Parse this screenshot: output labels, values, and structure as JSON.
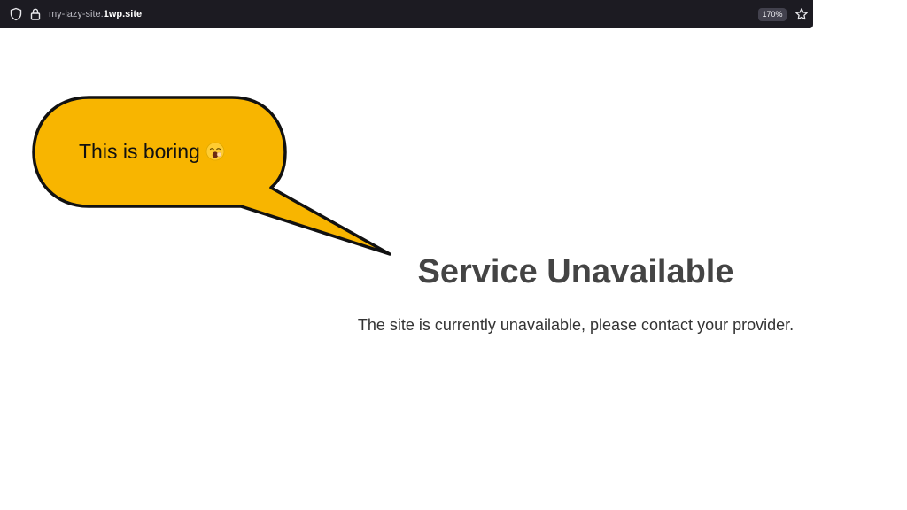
{
  "browser": {
    "url_subdomain": "my-lazy-site.",
    "url_domain": "1wp.site",
    "zoom_level": "170%",
    "icons": [
      "shield-icon",
      "lock-icon",
      "star-icon"
    ]
  },
  "callout": {
    "text": "This is boring",
    "emoji": "yawning-face-emoji",
    "fill_color": "#f8b500",
    "border_color": "#111111"
  },
  "main": {
    "title": "Service Unavailable",
    "message": "The site is currently unavailable, please contact your provider."
  },
  "colors": {
    "title": "#444444",
    "message": "#333333",
    "toolbar_bg": "#1c1b22"
  }
}
